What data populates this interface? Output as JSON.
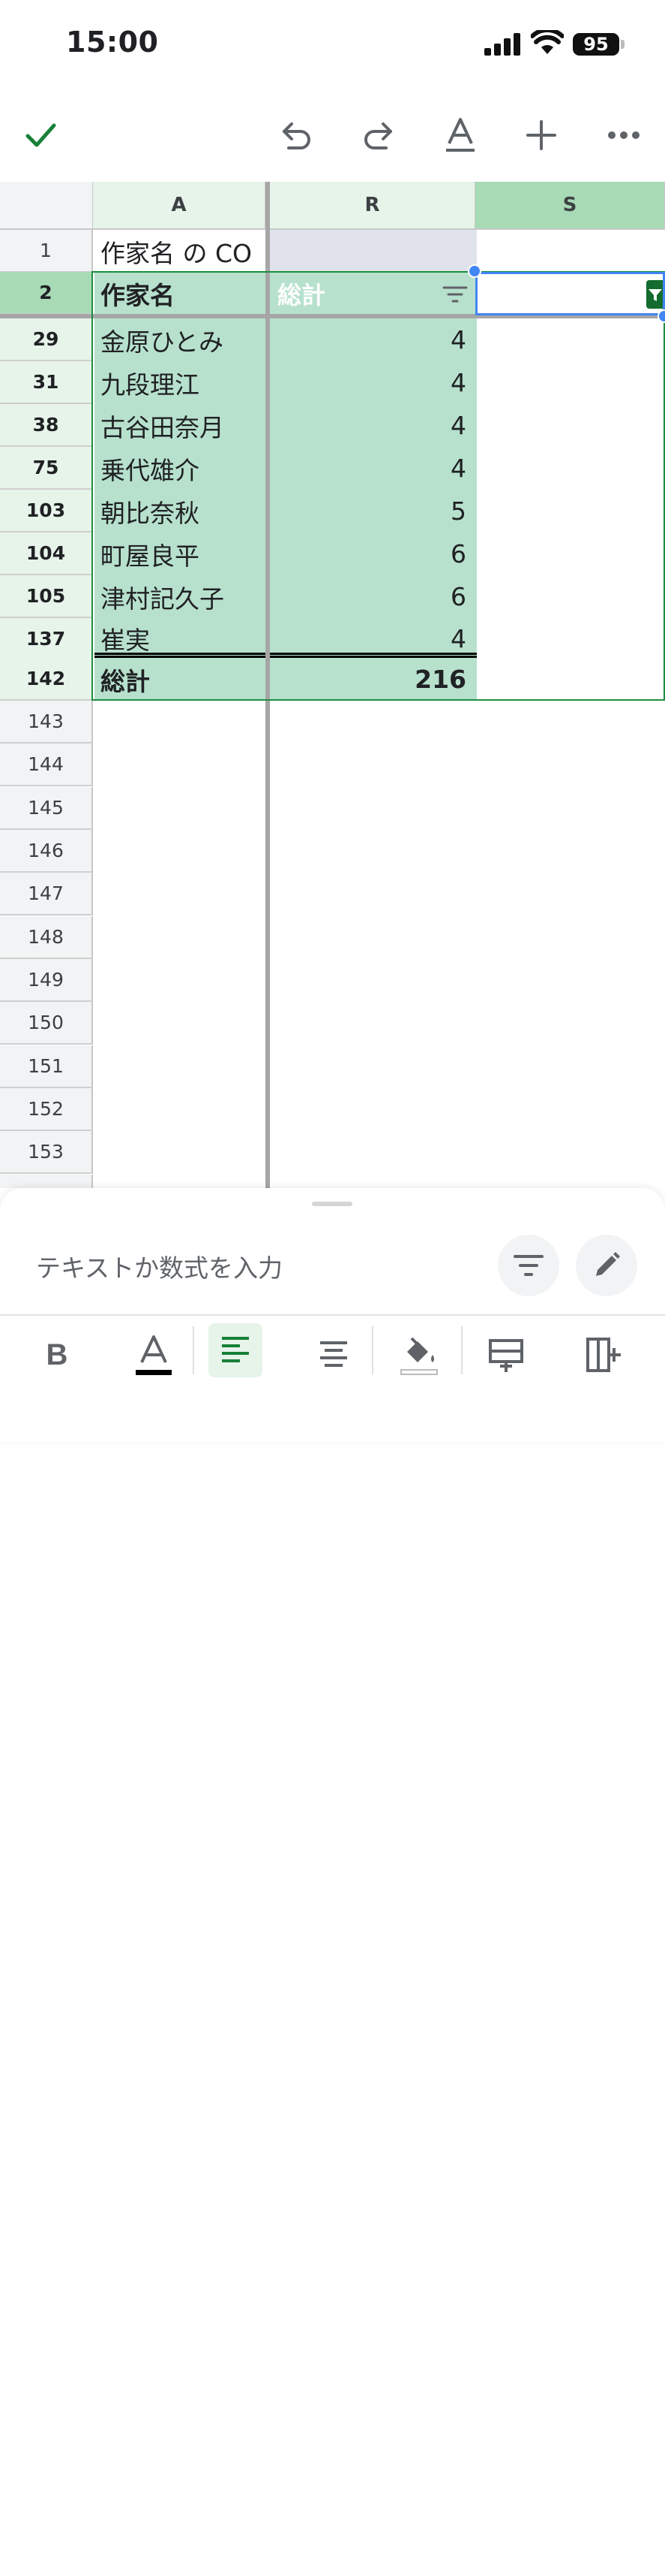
{
  "status_bar": {
    "time": "15:00",
    "battery": "95"
  },
  "toolbar": {
    "icons": [
      "check-icon",
      "undo-icon",
      "redo-icon",
      "text-format-icon",
      "add-icon",
      "more-icon"
    ],
    "accent": "#188038"
  },
  "grid": {
    "columns": [
      "A",
      "R",
      "S"
    ],
    "row1": {
      "num": "1",
      "a": "作家名 の CO",
      "r": ""
    },
    "header_row": {
      "num": "2",
      "a": "作家名",
      "r": "総計"
    },
    "rows": [
      {
        "num": "29",
        "a": "金原ひとみ",
        "r": "4"
      },
      {
        "num": "31",
        "a": "九段理江",
        "r": "4"
      },
      {
        "num": "38",
        "a": "古谷田奈月",
        "r": "4"
      },
      {
        "num": "75",
        "a": "乗代雄介",
        "r": "4"
      },
      {
        "num": "103",
        "a": "朝比奈秋",
        "r": "5"
      },
      {
        "num": "104",
        "a": "町屋良平",
        "r": "6"
      },
      {
        "num": "105",
        "a": "津村記久子",
        "r": "6"
      },
      {
        "num": "137",
        "a": "崔実",
        "r": "4"
      }
    ],
    "total_row": {
      "num": "142",
      "a": "総計",
      "r": "216"
    },
    "empty_rows": [
      "143",
      "144",
      "145",
      "146",
      "147",
      "148",
      "149",
      "150",
      "151",
      "152",
      "153"
    ],
    "selection_color": "#b7e1cd"
  },
  "bottom": {
    "formula_placeholder": "テキストか数式を入力",
    "format_icons": [
      "bold-icon",
      "text-color-icon",
      "align-left-icon",
      "align-center-icon",
      "fill-color-icon",
      "insert-row-icon",
      "insert-column-icon"
    ]
  }
}
